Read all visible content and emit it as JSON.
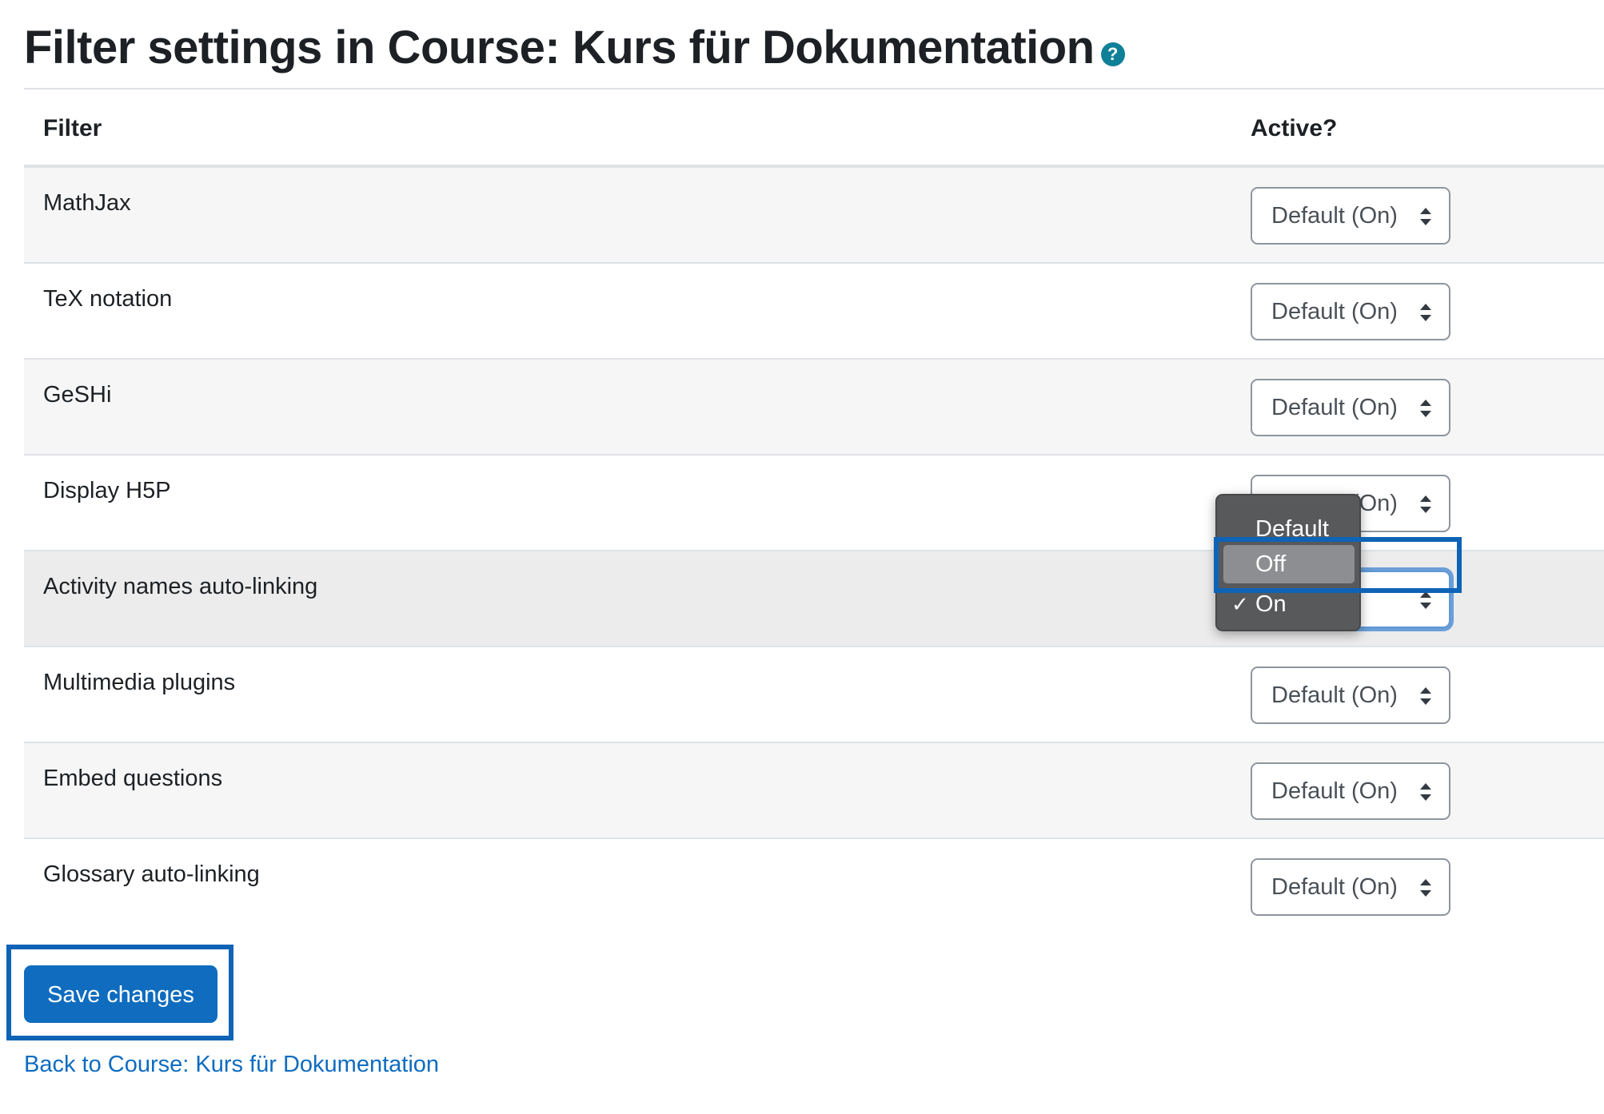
{
  "page": {
    "title": "Filter settings in Course: Kurs für Dokumentation",
    "help_icon": "question-circle-icon"
  },
  "table": {
    "headers": {
      "filter": "Filter",
      "active": "Active?"
    },
    "rows": [
      {
        "label": "MathJax",
        "value": "Default (On)"
      },
      {
        "label": "TeX notation",
        "value": "Default (On)"
      },
      {
        "label": "GeSHi",
        "value": "Default (On)"
      },
      {
        "label": "Display H5P",
        "value": "Default (On)"
      },
      {
        "label": "Activity names auto-linking",
        "value": "On"
      },
      {
        "label": "Multimedia plugins",
        "value": "Default (On)"
      },
      {
        "label": "Embed questions",
        "value": "Default (On)"
      },
      {
        "label": "Glossary auto-linking",
        "value": "Default (On)"
      }
    ]
  },
  "dropdown": {
    "options": [
      {
        "label": "Default (On)",
        "checked": false,
        "hovered": false
      },
      {
        "label": "Off",
        "checked": false,
        "hovered": true
      },
      {
        "label": "On",
        "checked": true,
        "hovered": false
      }
    ],
    "check_mark": "✓"
  },
  "actions": {
    "save_label": "Save changes",
    "back_link": "Back to Course: Kurs für Dokumentation"
  },
  "colors": {
    "primary": "#0f6cbf",
    "highlight": "#0f63b6",
    "help_icon": "#0f8098"
  }
}
